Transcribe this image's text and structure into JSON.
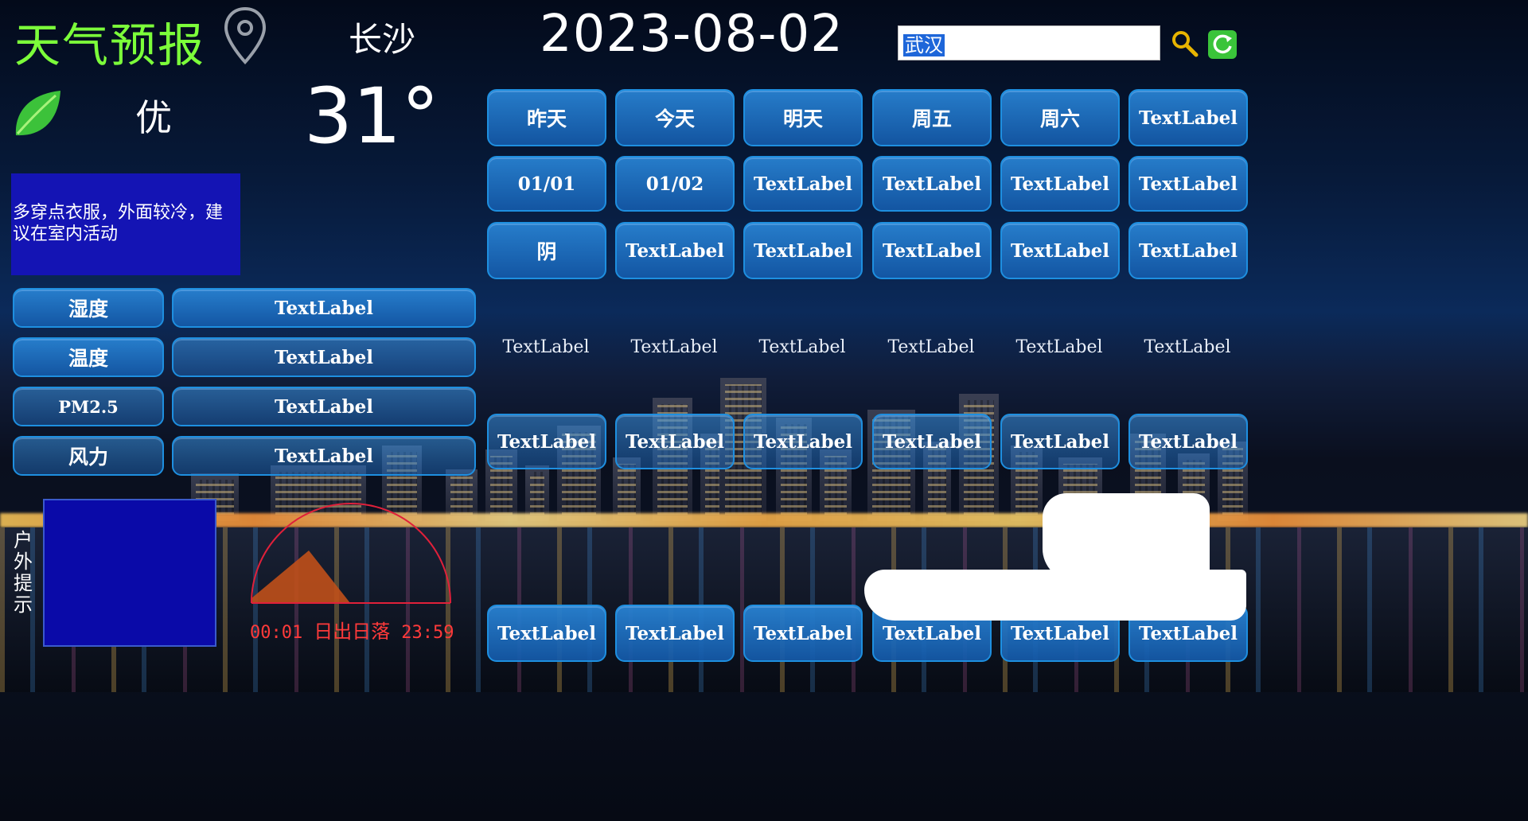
{
  "header": {
    "app_title": "天气预报",
    "city": "长沙",
    "date": "2023-08-02",
    "search_value": "武汉"
  },
  "current": {
    "air_quality": "优",
    "temperature": "31°",
    "advice": "多穿点衣服，外面较冷，建议在室内活动"
  },
  "details": [
    {
      "label": "湿度",
      "value": "TextLabel"
    },
    {
      "label": "温度",
      "value": "TextLabel"
    },
    {
      "label": "PM2.5",
      "value": "TextLabel"
    },
    {
      "label": "风力",
      "value": "TextLabel"
    }
  ],
  "forecast": {
    "days": [
      "昨天",
      "今天",
      "明天",
      "周五",
      "周六",
      "TextLabel"
    ],
    "dates": [
      "01/01",
      "01/02",
      "TextLabel",
      "TextLabel",
      "TextLabel",
      "TextLabel"
    ],
    "weather": [
      "阴",
      "TextLabel",
      "TextLabel",
      "TextLabel",
      "TextLabel",
      "TextLabel"
    ],
    "plain": [
      "TextLabel",
      "TextLabel",
      "TextLabel",
      "TextLabel",
      "TextLabel",
      "TextLabel"
    ],
    "row5": [
      "TextLabel",
      "TextLabel",
      "TextLabel",
      "TextLabel",
      "TextLabel",
      "TextLabel"
    ],
    "bottom": [
      "TextLabel",
      "TextLabel",
      "TextLabel",
      "TextLabel",
      "TextLabel",
      "TextLabel"
    ]
  },
  "outdoor": {
    "label": "户外提示"
  },
  "sun": {
    "sunrise": "00:01",
    "title": "日出日落",
    "sunset": "23:59",
    "arc_color": "#e0203a",
    "fill_color": "#c0501a"
  },
  "colors": {
    "title_green": "#7cff3a",
    "button_blue": "#1e78c8",
    "advice_bg": "#1414b4"
  },
  "icons": {
    "location": "map-pin-icon",
    "leaf": "leaf-icon",
    "search": "magnifier-icon",
    "refresh": "refresh-icon"
  }
}
